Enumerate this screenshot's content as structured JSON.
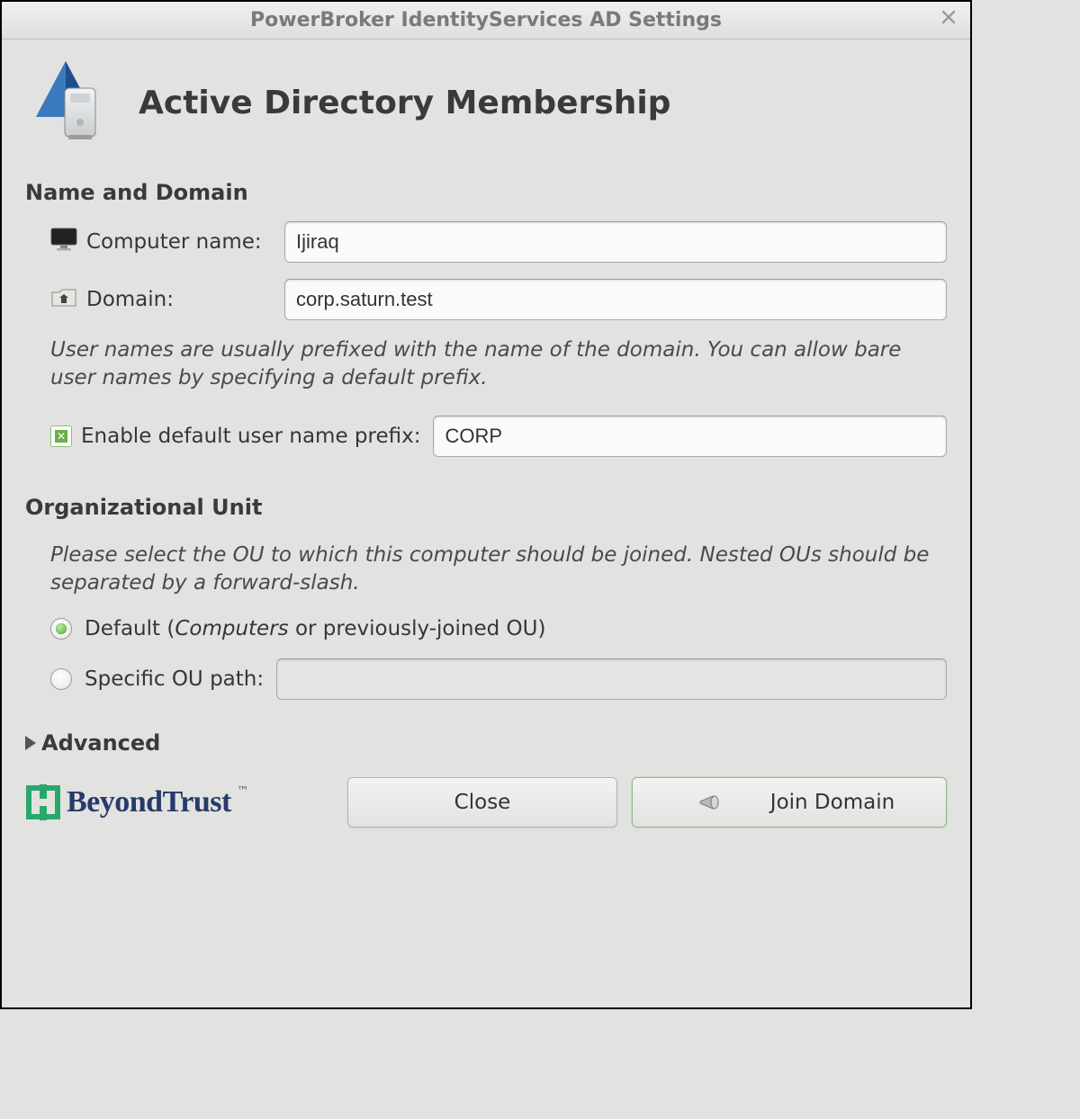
{
  "window": {
    "title": "PowerBroker IdentityServices AD Settings"
  },
  "header": {
    "heading": "Active Directory Membership"
  },
  "name_domain": {
    "section": "Name and Domain",
    "computer_label": "Computer name:",
    "computer_value": "Ijiraq",
    "domain_label": "Domain:",
    "domain_value": "corp.saturn.test",
    "help": "User names are usually prefixed with the name of the domain.  You can allow bare user names by specifying a default prefix.",
    "enable_prefix_label": "Enable default user name prefix:",
    "enable_prefix_checked": true,
    "prefix_value": "CORP"
  },
  "ou": {
    "section": "Organizational Unit",
    "help": "Please select the OU to which this computer should be joined. Nested OUs should be separated by a forward-slash.",
    "default_label_pre": "Default (",
    "default_label_ital": "Computers",
    "default_label_post": " or previously-joined OU)",
    "specific_label": "Specific OU path:",
    "specific_value": "",
    "selected": "default"
  },
  "advanced": {
    "label": "Advanced"
  },
  "footer": {
    "brand": "BeyondTrust",
    "close_label": "Close",
    "join_label": "Join Domain"
  }
}
